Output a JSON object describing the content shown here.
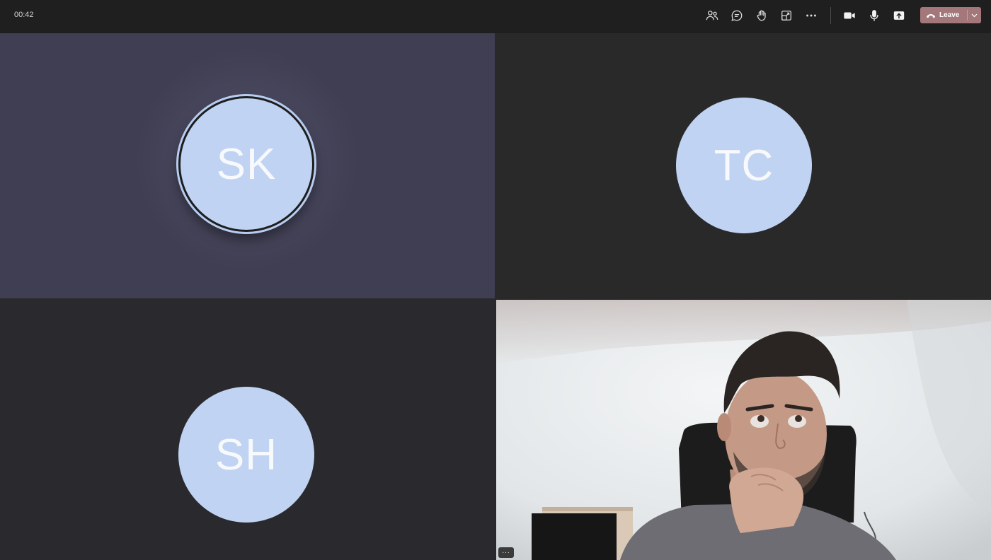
{
  "toolbar": {
    "timer": "00:42",
    "leave_label": "Leave",
    "icons": [
      "people-icon",
      "chat-icon",
      "raise-hand-icon",
      "share-tray-icon",
      "more-icon",
      "camera-icon",
      "mic-icon",
      "share-screen-icon"
    ],
    "leave_color": "#a4787b"
  },
  "participants": [
    {
      "initials": "SK",
      "speaking": true,
      "tile_color": "#3f3e52"
    },
    {
      "initials": "TC",
      "speaking": false,
      "tile_color": "#292929"
    },
    {
      "initials": "SH",
      "speaking": false,
      "tile_color": "#2a2a2e"
    }
  ],
  "avatar_color": "#c0d3f2",
  "video_tile": {
    "more_label": "..."
  }
}
